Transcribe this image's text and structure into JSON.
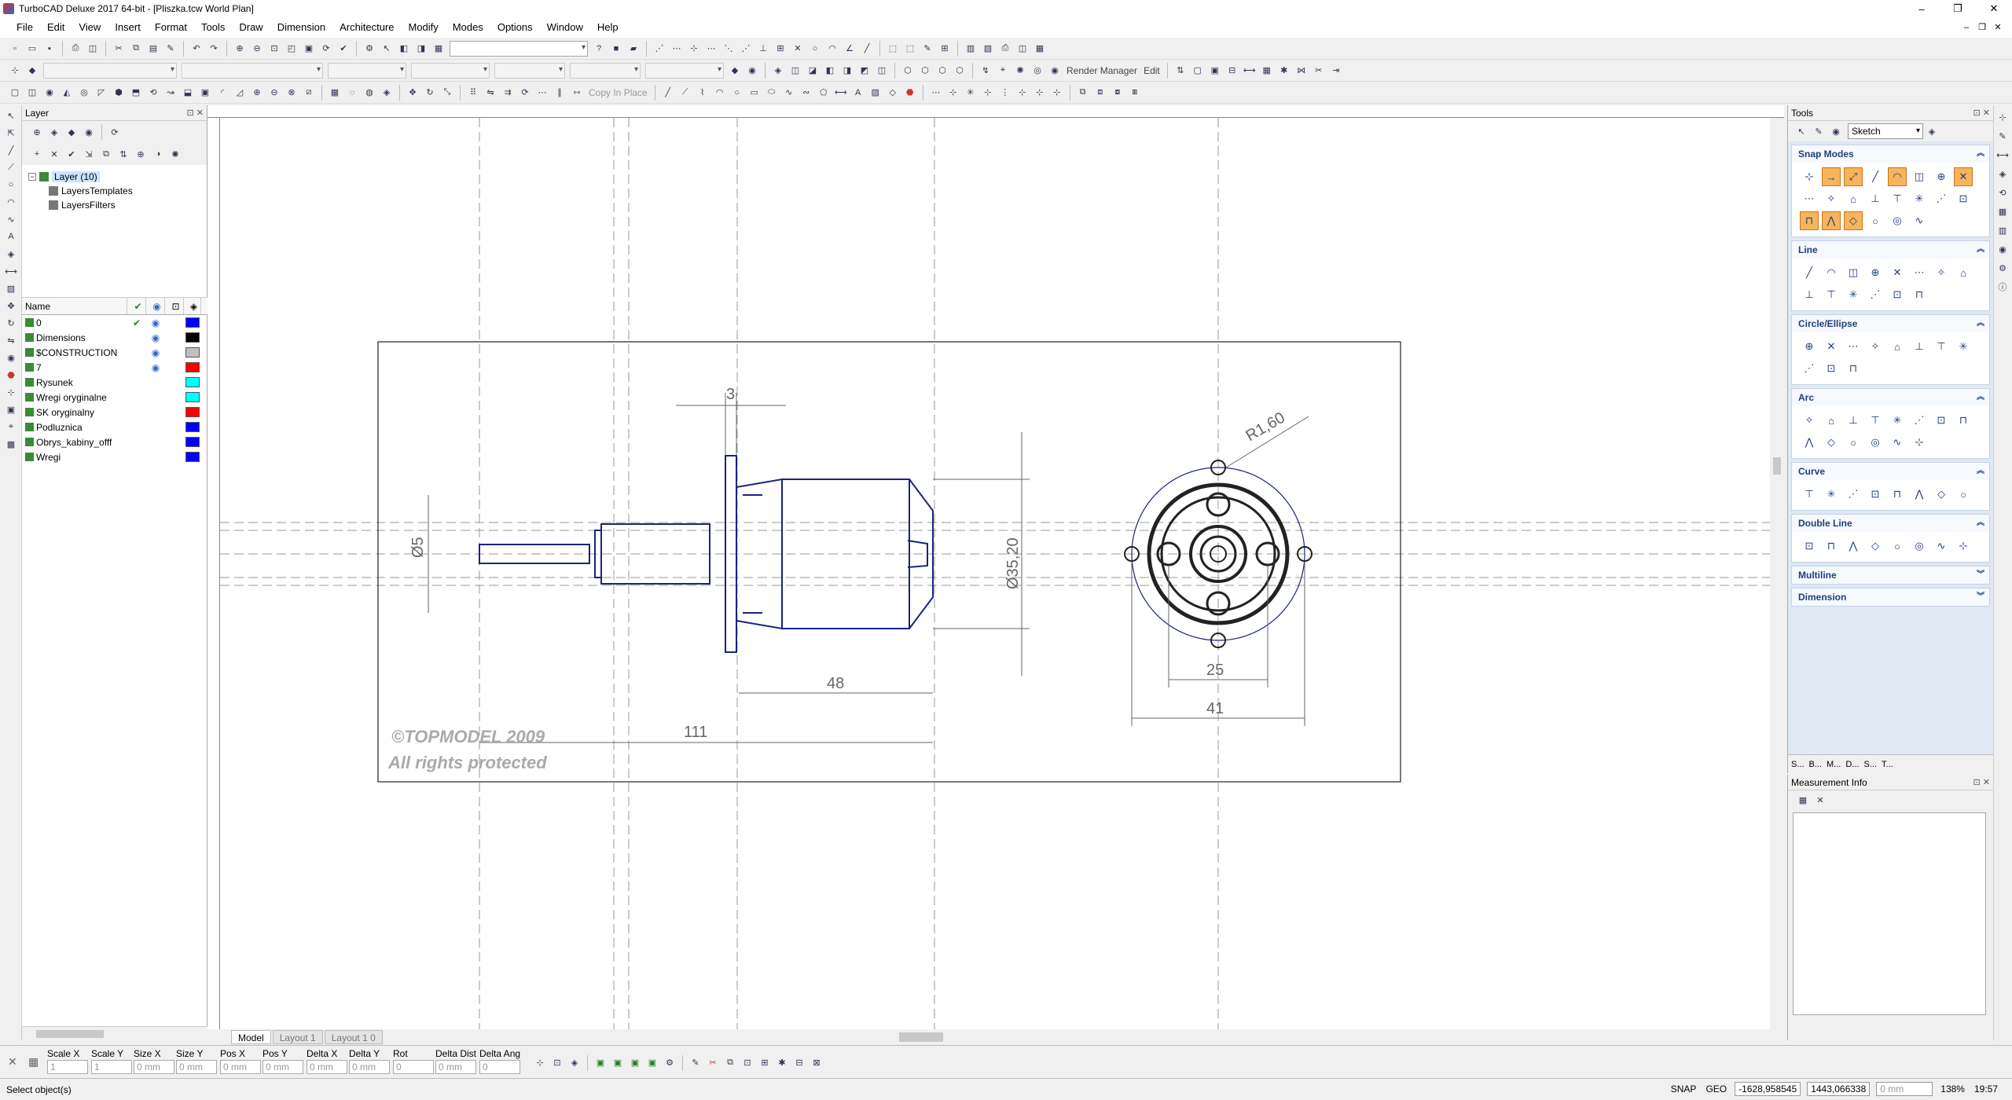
{
  "window": {
    "title": "TurboCAD Deluxe 2017 64-bit - [Pliszka.tcw World Plan]",
    "minimize": "–",
    "maximize": "❐",
    "close": "✕"
  },
  "menu": [
    "File",
    "Edit",
    "View",
    "Insert",
    "Format",
    "Tools",
    "Draw",
    "Dimension",
    "Architecture",
    "Modify",
    "Modes",
    "Options",
    "Window",
    "Help"
  ],
  "toolbar": {
    "copy_in_place": "Copy In Place",
    "render_manager": "Render Manager",
    "edit": "Edit"
  },
  "layer_panel": {
    "title": "Layer",
    "tree": {
      "root": "Layer (10)",
      "children": [
        "LayersTemplates",
        "LayersFilters"
      ]
    },
    "columns": {
      "name": "Name"
    },
    "layers": [
      {
        "name": "0",
        "active": true,
        "visible": true,
        "color": "#0000ff"
      },
      {
        "name": "Dimensions",
        "active": false,
        "visible": true,
        "color": "#000000"
      },
      {
        "name": "$CONSTRUCTION",
        "active": false,
        "visible": true,
        "color": "#c0c0c0"
      },
      {
        "name": "7",
        "active": false,
        "visible": true,
        "color": "#ff0000"
      },
      {
        "name": "Rysunek",
        "active": false,
        "visible": false,
        "color": "#00ffff"
      },
      {
        "name": "Wregi oryginalne",
        "active": false,
        "visible": false,
        "color": "#00ffff"
      },
      {
        "name": "SK oryginalny",
        "active": false,
        "visible": false,
        "color": "#ff0000"
      },
      {
        "name": "Podluznica",
        "active": false,
        "visible": false,
        "color": "#0000ff"
      },
      {
        "name": "Obrys_kabiny_offf",
        "active": false,
        "visible": false,
        "color": "#0000ff"
      },
      {
        "name": "Wregi",
        "active": false,
        "visible": false,
        "color": "#0000ff"
      }
    ]
  },
  "tabs": [
    "Model",
    "Layout 1",
    "Layout 1 0"
  ],
  "drawing": {
    "dimensions": {
      "width_3": "3",
      "radius": "R1,60",
      "shaft_dia": "Ø5",
      "body_dia": "Ø35,20",
      "len_48": "48",
      "len_111": "111",
      "mount_25": "25",
      "mount_41": "41"
    },
    "watermark": [
      "©TOPMODEL 2009",
      "All rights protected"
    ]
  },
  "tools_panel": {
    "title": "Tools",
    "mode": "Sketch",
    "sections": [
      {
        "name": "Snap Modes",
        "expanded": true,
        "icons": 22
      },
      {
        "name": "Line",
        "expanded": true,
        "icons": 14
      },
      {
        "name": "Circle/Ellipse",
        "expanded": true,
        "icons": 11
      },
      {
        "name": "Arc",
        "expanded": true,
        "icons": 14
      },
      {
        "name": "Curve",
        "expanded": true,
        "icons": 8
      },
      {
        "name": "Double Line",
        "expanded": true,
        "icons": 8
      },
      {
        "name": "Multiline",
        "expanded": false,
        "icons": 0
      },
      {
        "name": "Dimension",
        "expanded": false,
        "icons": 0
      }
    ],
    "bottom_tabs": [
      "S...",
      "B...",
      "M...",
      "D...",
      "S...",
      "T..."
    ]
  },
  "measurement_panel": {
    "title": "Measurement Info"
  },
  "input_bar": {
    "fields": [
      {
        "label": "Scale X",
        "value": "1"
      },
      {
        "label": "Scale Y",
        "value": "1"
      },
      {
        "label": "Size X",
        "value": "0 mm"
      },
      {
        "label": "Size Y",
        "value": "0 mm"
      },
      {
        "label": "Pos X",
        "value": "0 mm"
      },
      {
        "label": "Pos Y",
        "value": "0 mm"
      },
      {
        "label": "Delta X",
        "value": "0 mm"
      },
      {
        "label": "Delta Y",
        "value": "0 mm"
      },
      {
        "label": "Rot",
        "value": "0"
      },
      {
        "label": "Delta Dist",
        "value": "0 mm"
      },
      {
        "label": "Delta Ang",
        "value": "0"
      }
    ]
  },
  "status": {
    "message": "Select object(s)",
    "snap": "SNAP",
    "geo": "GEO",
    "coord_x": "-1628,958545",
    "coord_y": "1443,066338",
    "length": "0 mm",
    "zoom": "138%",
    "time": "19:57"
  }
}
